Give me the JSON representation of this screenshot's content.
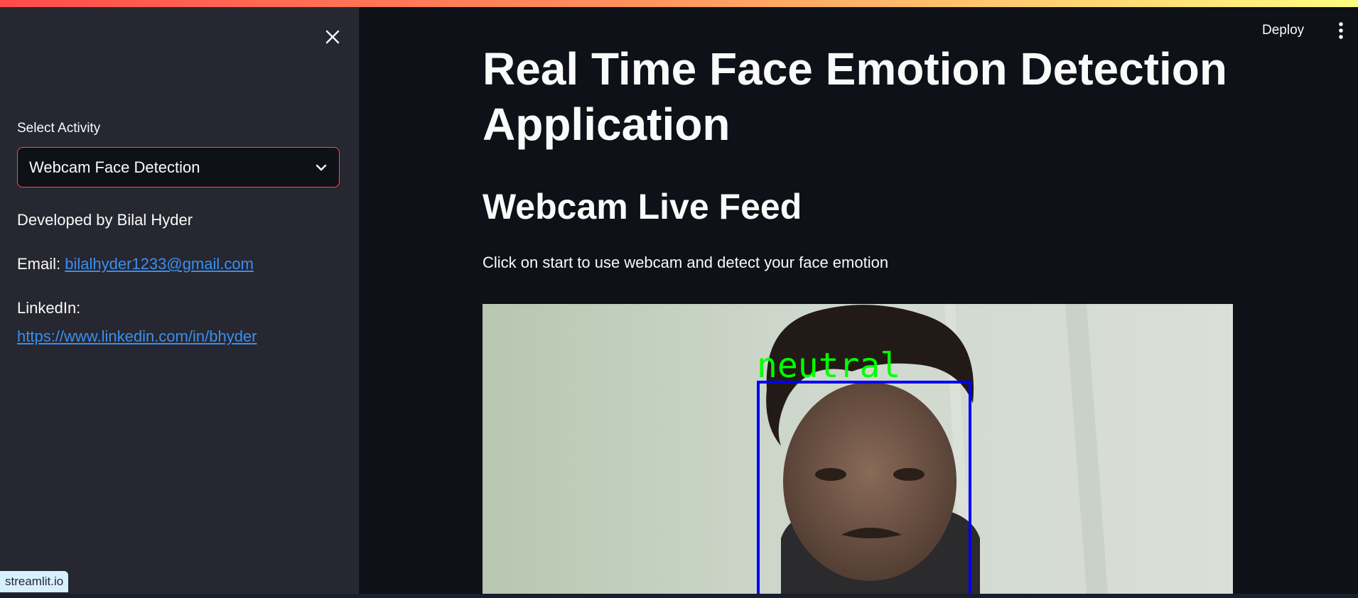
{
  "sidebar": {
    "select_label": "Select Activity",
    "select_value": "Webcam Face Detection",
    "developer_text": "Developed by Bilal Hyder",
    "email_label": "Email:",
    "email_link": "bilalhyder1233@gmail.com",
    "linkedin_label": "LinkedIn:",
    "linkedin_link": "https://www.linkedin.com/in/bhyder"
  },
  "header": {
    "deploy_label": "Deploy"
  },
  "main": {
    "title": "Real Time Face Emotion Detection Application",
    "subtitle": "Webcam Live Feed",
    "description": "Click on start to use webcam and detect your face emotion",
    "detection_label": "neutral"
  },
  "footer": {
    "badge_label": "streamlit.io"
  },
  "colors": {
    "background": "#0e1117",
    "sidebar": "#262730",
    "accent": "#ff4b4b",
    "link": "#3a8ff2",
    "detection_box": "#0000ff",
    "detection_label": "#00ff00"
  },
  "icons": {
    "close": "close-icon",
    "dropdown": "chevron-down-icon",
    "menu": "vertical-dots-icon"
  }
}
